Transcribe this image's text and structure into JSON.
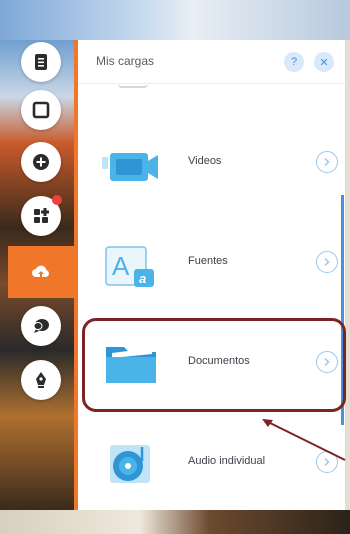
{
  "panel": {
    "title": "Mis cargas",
    "help_glyph": "?",
    "close_glyph": "✕"
  },
  "toolbar": {
    "tools": [
      {
        "icon": "document-icon"
      },
      {
        "icon": "square-icon"
      },
      {
        "icon": "add-icon"
      },
      {
        "icon": "apps-icon"
      },
      {
        "icon": "cloud-upload-icon"
      },
      {
        "icon": "chat-icon"
      },
      {
        "icon": "pen-icon"
      }
    ],
    "active_color": "#f0762a"
  },
  "items": [
    {
      "label": "Videos",
      "icon": "video-camera-icon"
    },
    {
      "label": "Fuentes",
      "icon": "font-icon"
    },
    {
      "label": "Documentos",
      "icon": "folder-icon"
    },
    {
      "label": "Audio individual",
      "icon": "music-disc-icon"
    }
  ],
  "colors": {
    "accent": "#f0762a",
    "icon_blue": "#4ab3e8",
    "highlight": "#7a2424",
    "scroll": "#4a90e2"
  }
}
